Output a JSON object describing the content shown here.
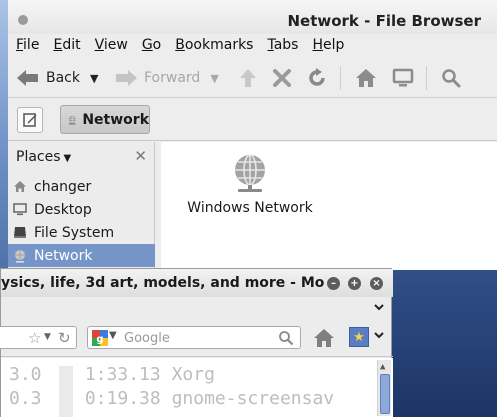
{
  "file_browser": {
    "title": "Network - File Browser",
    "menu": [
      "File",
      "Edit",
      "View",
      "Go",
      "Bookmarks",
      "Tabs",
      "Help"
    ],
    "toolbar": {
      "back_label": "Back",
      "forward_label": "Forward",
      "icons": [
        "up-arrow-icon",
        "stop-icon",
        "reload-icon",
        "home-icon",
        "computer-icon",
        "search-icon"
      ]
    },
    "location": {
      "crumb_label": "Network"
    },
    "sidebar": {
      "header": "Places",
      "items": [
        {
          "label": "changer",
          "icon": "home-icon"
        },
        {
          "label": "Desktop",
          "icon": "desktop-icon"
        },
        {
          "label": "File System",
          "icon": "drive-icon"
        },
        {
          "label": "Network",
          "icon": "network-icon",
          "selected": true
        }
      ]
    },
    "content": {
      "items": [
        {
          "label": "Windows Network",
          "icon": "network-globe-icon"
        }
      ]
    }
  },
  "browser": {
    "title": "ysics, life, 3d art, models, and more - Mo",
    "search": {
      "placeholder": "Google"
    }
  },
  "terminal": {
    "rows": [
      {
        "cpu": "3.0",
        "time": "1:33.13",
        "command": "Xorg"
      },
      {
        "cpu": "0.3",
        "time": "0:19.38",
        "command": "gnome-screensav"
      }
    ]
  },
  "colors": {
    "selection": "#7595c8",
    "content_bg": "#ffffff",
    "window_bg": "#ededed"
  }
}
